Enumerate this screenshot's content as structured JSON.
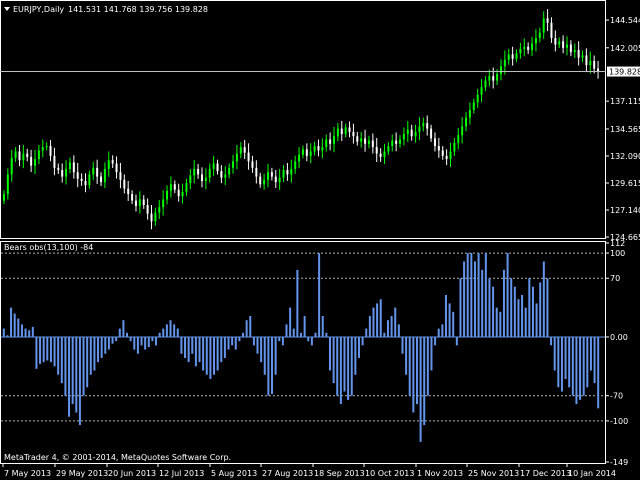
{
  "chart_data": [
    {
      "type": "candlestick",
      "symbol": "EURJPY,Daily",
      "ohlc_header": "141.531 141.768 139.756 139.828",
      "current_price": "139.828",
      "ylim": [
        124.665,
        146.2
      ],
      "y_ticks": [
        "144.544",
        "142.005",
        "139.828",
        "137.115",
        "134.565",
        "132.090",
        "129.615",
        "127.140",
        "124.665"
      ],
      "colors": {
        "up": "#00ff00",
        "down": "#ffffff",
        "price_line": "#c0c0c0"
      },
      "close_series": [
        128.6,
        130.4,
        131.9,
        132.5,
        131.7,
        132.3,
        132.0,
        131.2,
        131.8,
        132.6,
        132.9,
        133.0,
        132.1,
        131.0,
        130.8,
        130.2,
        130.9,
        131.5,
        130.6,
        130.0,
        129.8,
        129.4,
        130.4,
        131.0,
        130.2,
        129.7,
        130.9,
        131.7,
        131.4,
        130.6,
        129.9,
        129.1,
        128.6,
        128.0,
        127.5,
        128.1,
        127.6,
        126.8,
        126.1,
        126.9,
        127.4,
        128.1,
        128.9,
        129.5,
        129.0,
        128.4,
        128.8,
        129.6,
        130.3,
        130.9,
        130.4,
        129.8,
        130.1,
        130.9,
        131.4,
        130.7,
        130.1,
        130.4,
        131.0,
        131.6,
        132.3,
        132.9,
        132.4,
        131.6,
        131.0,
        130.2,
        129.5,
        129.9,
        130.6,
        130.2,
        129.7,
        130.1,
        130.8,
        130.4,
        130.9,
        131.6,
        132.2,
        132.7,
        132.1,
        132.5,
        133.0,
        132.6,
        132.9,
        133.6,
        133.2,
        133.9,
        134.6,
        134.1,
        134.7,
        134.3,
        133.9,
        133.4,
        133.7,
        133.2,
        133.5,
        132.9,
        132.3,
        132.0,
        132.5,
        133.0,
        133.5,
        133.2,
        133.6,
        134.1,
        134.5,
        133.9,
        134.3,
        134.8,
        135.1,
        134.6,
        133.7,
        133.0,
        132.6,
        132.1,
        131.8,
        132.5,
        133.3,
        134.0,
        134.8,
        135.6,
        136.3,
        137.0,
        137.7,
        138.4,
        139.0,
        139.4,
        139.0,
        139.6,
        140.3,
        140.9,
        141.4,
        141.0,
        141.5,
        141.9,
        142.1,
        141.8,
        142.4,
        142.9,
        143.4,
        144.7,
        144.3,
        142.9,
        142.3,
        142.6,
        142.0,
        142.3,
        141.6,
        141.8,
        141.1,
        141.3,
        140.4,
        140.8,
        140.1,
        139.8
      ]
    },
    {
      "type": "bar",
      "indicator_label": "Bears obs(13,100) -84",
      "ylim": [
        -149,
        112
      ],
      "y_ticks": [
        "112",
        "100",
        "70",
        "0.00",
        "-70",
        "-100",
        "-149"
      ],
      "dashed_levels": [
        100,
        70,
        -70,
        -100
      ],
      "color": "#6495ed",
      "values": [
        10,
        2,
        35,
        28,
        22,
        15,
        10,
        8,
        12,
        -38,
        -32,
        -30,
        -28,
        -30,
        -35,
        -45,
        -55,
        -70,
        -95,
        -80,
        -90,
        -105,
        -70,
        -60,
        -45,
        -40,
        -30,
        -25,
        -20,
        -15,
        -8,
        -5,
        10,
        20,
        5,
        -5,
        -15,
        -20,
        -10,
        -15,
        -12,
        -5,
        -10,
        5,
        10,
        15,
        20,
        15,
        10,
        -20,
        -25,
        -30,
        -20,
        -35,
        -30,
        -40,
        -45,
        -50,
        -45,
        -40,
        -30,
        -25,
        -15,
        -10,
        -15,
        -5,
        5,
        20,
        25,
        -10,
        -20,
        -30,
        -45,
        -70,
        -68,
        -45,
        -5,
        -10,
        15,
        35,
        10,
        80,
        5,
        25,
        -5,
        -10,
        5,
        100,
        25,
        5,
        -40,
        -55,
        -70,
        -80,
        -65,
        -75,
        -70,
        -45,
        -25,
        -10,
        10,
        25,
        35,
        40,
        45,
        5,
        20,
        25,
        35,
        15,
        -20,
        -45,
        -70,
        -90,
        -80,
        -125,
        -105,
        -70,
        -40,
        -10,
        10,
        15,
        50,
        40,
        30,
        -10,
        70,
        90,
        100,
        100,
        90,
        100,
        80,
        100,
        70,
        60,
        35,
        30,
        80,
        100,
        70,
        60,
        45,
        50,
        35,
        70,
        60,
        40,
        65,
        90,
        70,
        -10,
        -40,
        -60,
        -65,
        -50,
        -60,
        -70,
        -80,
        -75,
        -70,
        -60,
        -40,
        -55,
        -85
      ]
    }
  ],
  "x_labels": [
    "7 May 2013",
    "29 May 2013",
    "20 Jun 2013",
    "12 Jul 2013",
    "5 Aug 2013",
    "27 Aug 2013",
    "18 Sep 2013",
    "10 Oct 2013",
    "1 Nov 2013",
    "25 Nov 2013",
    "17 Dec 2013",
    "10 Jan 2014"
  ],
  "copyright": "MetaTrader 4, © 2001-2014, MetaQuotes Software Corp."
}
